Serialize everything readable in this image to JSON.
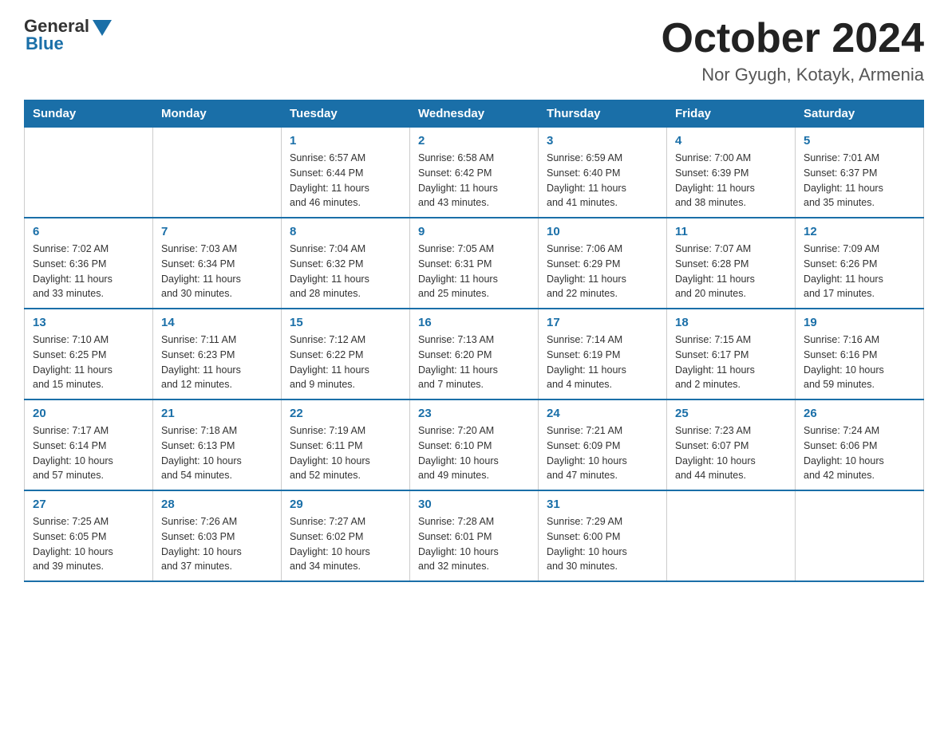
{
  "header": {
    "logo_general": "General",
    "logo_blue": "Blue",
    "month_title": "October 2024",
    "location": "Nor Gyugh, Kotayk, Armenia"
  },
  "days_of_week": [
    "Sunday",
    "Monday",
    "Tuesday",
    "Wednesday",
    "Thursday",
    "Friday",
    "Saturday"
  ],
  "weeks": [
    [
      {
        "day": "",
        "info": ""
      },
      {
        "day": "",
        "info": ""
      },
      {
        "day": "1",
        "info": "Sunrise: 6:57 AM\nSunset: 6:44 PM\nDaylight: 11 hours\nand 46 minutes."
      },
      {
        "day": "2",
        "info": "Sunrise: 6:58 AM\nSunset: 6:42 PM\nDaylight: 11 hours\nand 43 minutes."
      },
      {
        "day": "3",
        "info": "Sunrise: 6:59 AM\nSunset: 6:40 PM\nDaylight: 11 hours\nand 41 minutes."
      },
      {
        "day": "4",
        "info": "Sunrise: 7:00 AM\nSunset: 6:39 PM\nDaylight: 11 hours\nand 38 minutes."
      },
      {
        "day": "5",
        "info": "Sunrise: 7:01 AM\nSunset: 6:37 PM\nDaylight: 11 hours\nand 35 minutes."
      }
    ],
    [
      {
        "day": "6",
        "info": "Sunrise: 7:02 AM\nSunset: 6:36 PM\nDaylight: 11 hours\nand 33 minutes."
      },
      {
        "day": "7",
        "info": "Sunrise: 7:03 AM\nSunset: 6:34 PM\nDaylight: 11 hours\nand 30 minutes."
      },
      {
        "day": "8",
        "info": "Sunrise: 7:04 AM\nSunset: 6:32 PM\nDaylight: 11 hours\nand 28 minutes."
      },
      {
        "day": "9",
        "info": "Sunrise: 7:05 AM\nSunset: 6:31 PM\nDaylight: 11 hours\nand 25 minutes."
      },
      {
        "day": "10",
        "info": "Sunrise: 7:06 AM\nSunset: 6:29 PM\nDaylight: 11 hours\nand 22 minutes."
      },
      {
        "day": "11",
        "info": "Sunrise: 7:07 AM\nSunset: 6:28 PM\nDaylight: 11 hours\nand 20 minutes."
      },
      {
        "day": "12",
        "info": "Sunrise: 7:09 AM\nSunset: 6:26 PM\nDaylight: 11 hours\nand 17 minutes."
      }
    ],
    [
      {
        "day": "13",
        "info": "Sunrise: 7:10 AM\nSunset: 6:25 PM\nDaylight: 11 hours\nand 15 minutes."
      },
      {
        "day": "14",
        "info": "Sunrise: 7:11 AM\nSunset: 6:23 PM\nDaylight: 11 hours\nand 12 minutes."
      },
      {
        "day": "15",
        "info": "Sunrise: 7:12 AM\nSunset: 6:22 PM\nDaylight: 11 hours\nand 9 minutes."
      },
      {
        "day": "16",
        "info": "Sunrise: 7:13 AM\nSunset: 6:20 PM\nDaylight: 11 hours\nand 7 minutes."
      },
      {
        "day": "17",
        "info": "Sunrise: 7:14 AM\nSunset: 6:19 PM\nDaylight: 11 hours\nand 4 minutes."
      },
      {
        "day": "18",
        "info": "Sunrise: 7:15 AM\nSunset: 6:17 PM\nDaylight: 11 hours\nand 2 minutes."
      },
      {
        "day": "19",
        "info": "Sunrise: 7:16 AM\nSunset: 6:16 PM\nDaylight: 10 hours\nand 59 minutes."
      }
    ],
    [
      {
        "day": "20",
        "info": "Sunrise: 7:17 AM\nSunset: 6:14 PM\nDaylight: 10 hours\nand 57 minutes."
      },
      {
        "day": "21",
        "info": "Sunrise: 7:18 AM\nSunset: 6:13 PM\nDaylight: 10 hours\nand 54 minutes."
      },
      {
        "day": "22",
        "info": "Sunrise: 7:19 AM\nSunset: 6:11 PM\nDaylight: 10 hours\nand 52 minutes."
      },
      {
        "day": "23",
        "info": "Sunrise: 7:20 AM\nSunset: 6:10 PM\nDaylight: 10 hours\nand 49 minutes."
      },
      {
        "day": "24",
        "info": "Sunrise: 7:21 AM\nSunset: 6:09 PM\nDaylight: 10 hours\nand 47 minutes."
      },
      {
        "day": "25",
        "info": "Sunrise: 7:23 AM\nSunset: 6:07 PM\nDaylight: 10 hours\nand 44 minutes."
      },
      {
        "day": "26",
        "info": "Sunrise: 7:24 AM\nSunset: 6:06 PM\nDaylight: 10 hours\nand 42 minutes."
      }
    ],
    [
      {
        "day": "27",
        "info": "Sunrise: 7:25 AM\nSunset: 6:05 PM\nDaylight: 10 hours\nand 39 minutes."
      },
      {
        "day": "28",
        "info": "Sunrise: 7:26 AM\nSunset: 6:03 PM\nDaylight: 10 hours\nand 37 minutes."
      },
      {
        "day": "29",
        "info": "Sunrise: 7:27 AM\nSunset: 6:02 PM\nDaylight: 10 hours\nand 34 minutes."
      },
      {
        "day": "30",
        "info": "Sunrise: 7:28 AM\nSunset: 6:01 PM\nDaylight: 10 hours\nand 32 minutes."
      },
      {
        "day": "31",
        "info": "Sunrise: 7:29 AM\nSunset: 6:00 PM\nDaylight: 10 hours\nand 30 minutes."
      },
      {
        "day": "",
        "info": ""
      },
      {
        "day": "",
        "info": ""
      }
    ]
  ]
}
